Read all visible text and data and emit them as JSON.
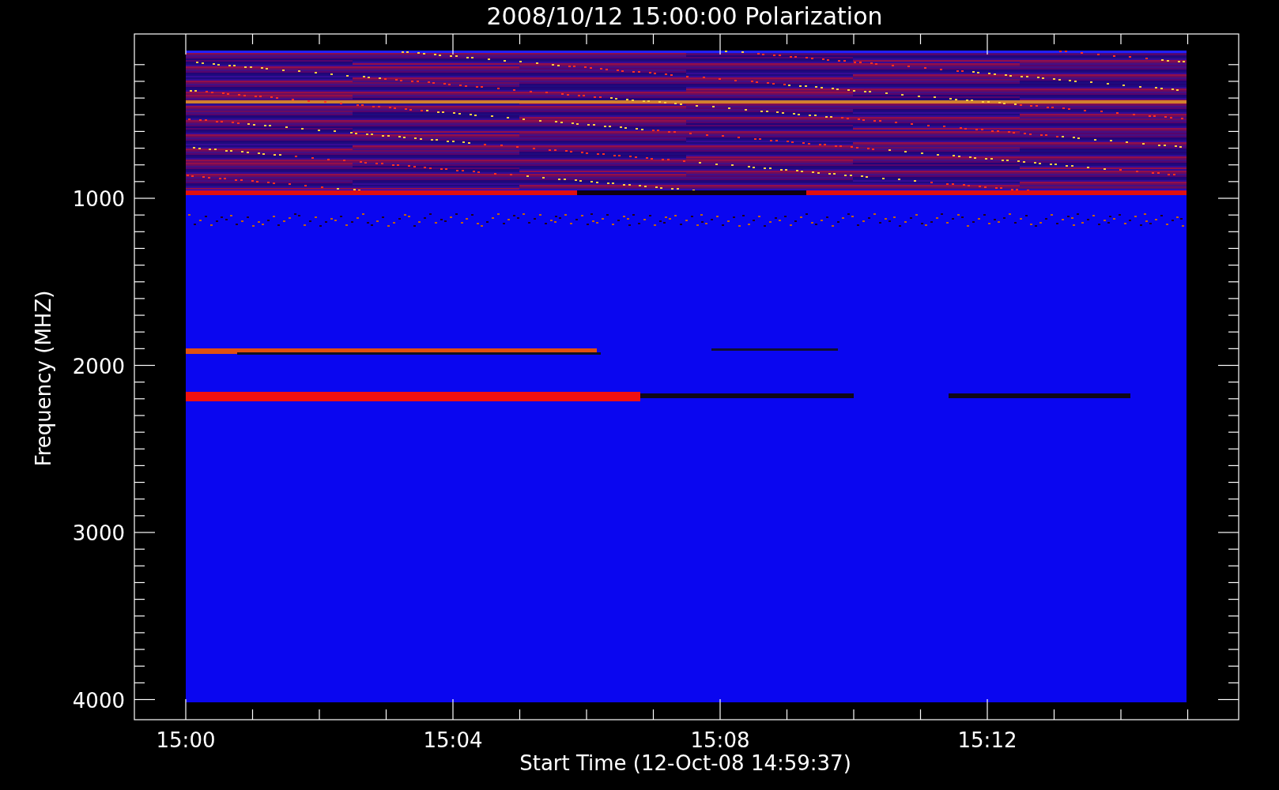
{
  "title": "2008/10/12 15:00:00 Polarization",
  "y_axis": {
    "label": "Frequency (MHZ)",
    "ticks": [
      "1000",
      "2000",
      "3000",
      "4000"
    ]
  },
  "x_axis": {
    "label": "Start Time (12-Oct-08 14:59:37)",
    "ticks": [
      "15:00",
      "15:04",
      "15:08",
      "15:12"
    ]
  }
}
